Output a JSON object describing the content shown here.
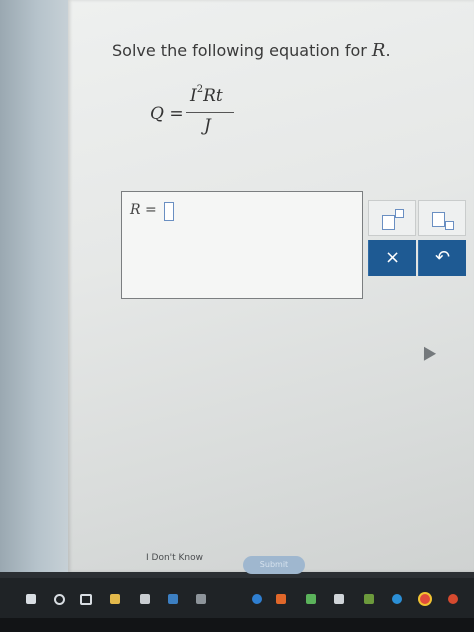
{
  "question": {
    "prompt_prefix": "Solve the following equation for ",
    "prompt_var": "R",
    "prompt_suffix": "."
  },
  "equation": {
    "lhs": "Q =",
    "numerator_base": "I",
    "numerator_exp": "2",
    "numerator_rest": "Rt",
    "denominator": "J"
  },
  "answer": {
    "label": "R ="
  },
  "palette": {
    "clear_label": "×",
    "undo_label": "↶"
  },
  "footer": {
    "dont_know": "I Don't Know",
    "submit": "Submit"
  },
  "colors": {
    "accent": "#1e5a93",
    "input_border": "#6a8fc2"
  },
  "taskbar_icons": [
    "windows-icon",
    "search-icon",
    "task-view-icon",
    "file-explorer-icon",
    "store-icon",
    "mail-icon",
    "app-icon",
    "browser-icon",
    "chrome-icon"
  ]
}
